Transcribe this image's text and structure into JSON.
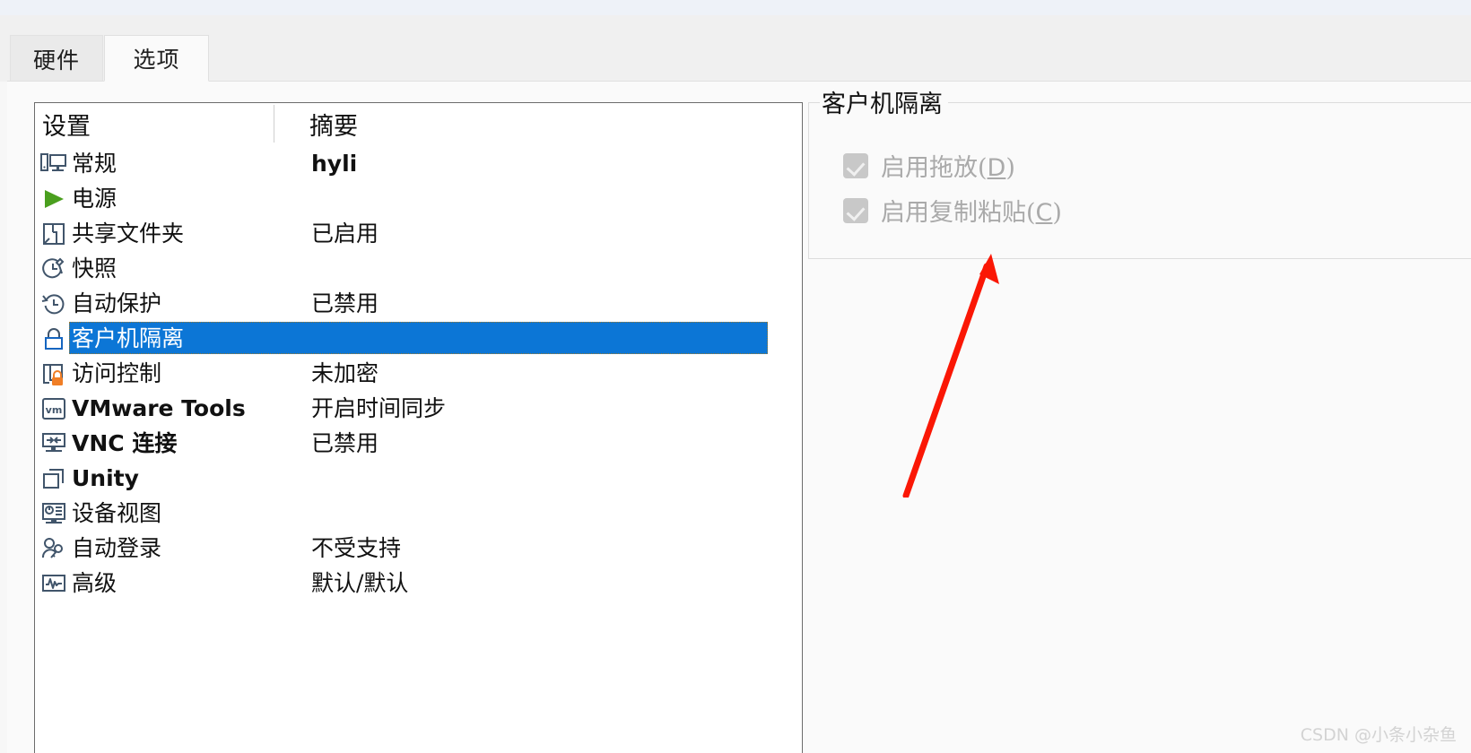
{
  "window": {
    "tabs": [
      {
        "label": "硬件",
        "active": false,
        "name": "tab-hardware"
      },
      {
        "label": "选项",
        "active": true,
        "name": "tab-options"
      }
    ]
  },
  "settings_list": {
    "columns": {
      "settings": "设置",
      "summary": "摘要"
    },
    "selected_index": 5,
    "rows": [
      {
        "icon": "monitor-icon",
        "label": "常规",
        "summary": "hyli",
        "latin_label": false,
        "latin_summary": true
      },
      {
        "icon": "play-triangle-icon",
        "label": "电源",
        "summary": "",
        "latin_label": false,
        "latin_summary": false
      },
      {
        "icon": "shared-folder-icon",
        "label": "共享文件夹",
        "summary": "已启用",
        "latin_label": false,
        "latin_summary": false
      },
      {
        "icon": "snapshot-icon",
        "label": "快照",
        "summary": "",
        "latin_label": false,
        "latin_summary": false
      },
      {
        "icon": "autoprotect-icon",
        "label": "自动保护",
        "summary": "已禁用",
        "latin_label": false,
        "latin_summary": false
      },
      {
        "icon": "lock-icon",
        "label": "客户机隔离",
        "summary": "",
        "latin_label": false,
        "latin_summary": false
      },
      {
        "icon": "access-control-icon",
        "label": "访问控制",
        "summary": "未加密",
        "latin_label": false,
        "latin_summary": false
      },
      {
        "icon": "vmware-tools-icon",
        "label": "VMware Tools",
        "summary": "开启时间同步",
        "latin_label": true,
        "latin_summary": false
      },
      {
        "icon": "vnc-icon",
        "label": "VNC 连接",
        "summary": "已禁用",
        "latin_label": true,
        "latin_summary": false
      },
      {
        "icon": "unity-icon",
        "label": "Unity",
        "summary": "",
        "latin_label": true,
        "latin_summary": false
      },
      {
        "icon": "device-view-icon",
        "label": "设备视图",
        "summary": "",
        "latin_label": false,
        "latin_summary": false
      },
      {
        "icon": "auto-login-icon",
        "label": "自动登录",
        "summary": "不受支持",
        "latin_label": false,
        "latin_summary": false
      },
      {
        "icon": "advanced-icon",
        "label": "高级",
        "summary": "默认/默认",
        "latin_label": false,
        "latin_summary": false
      }
    ]
  },
  "detail_panel": {
    "group_title": "客户机隔离",
    "checkboxes": [
      {
        "text_before": "启用拖放(",
        "accelerator": "D",
        "text_after": ")",
        "checked": true,
        "disabled": true,
        "name": "enable-drag-drop-checkbox"
      },
      {
        "text_before": "启用复制粘贴(",
        "accelerator": "C",
        "text_after": ")",
        "checked": true,
        "disabled": true,
        "name": "enable-copy-paste-checkbox"
      }
    ]
  },
  "annotation": {
    "arrow_color": "#fa1705"
  },
  "watermark": {
    "text": "CSDN @小条小杂鱼"
  },
  "colors": {
    "selection_blue": "#0c76d6",
    "icon_slate": "#41556b",
    "power_green": "#4a9f1e",
    "lock_orange": "#f07e26",
    "arrow_red": "#fa1705"
  }
}
